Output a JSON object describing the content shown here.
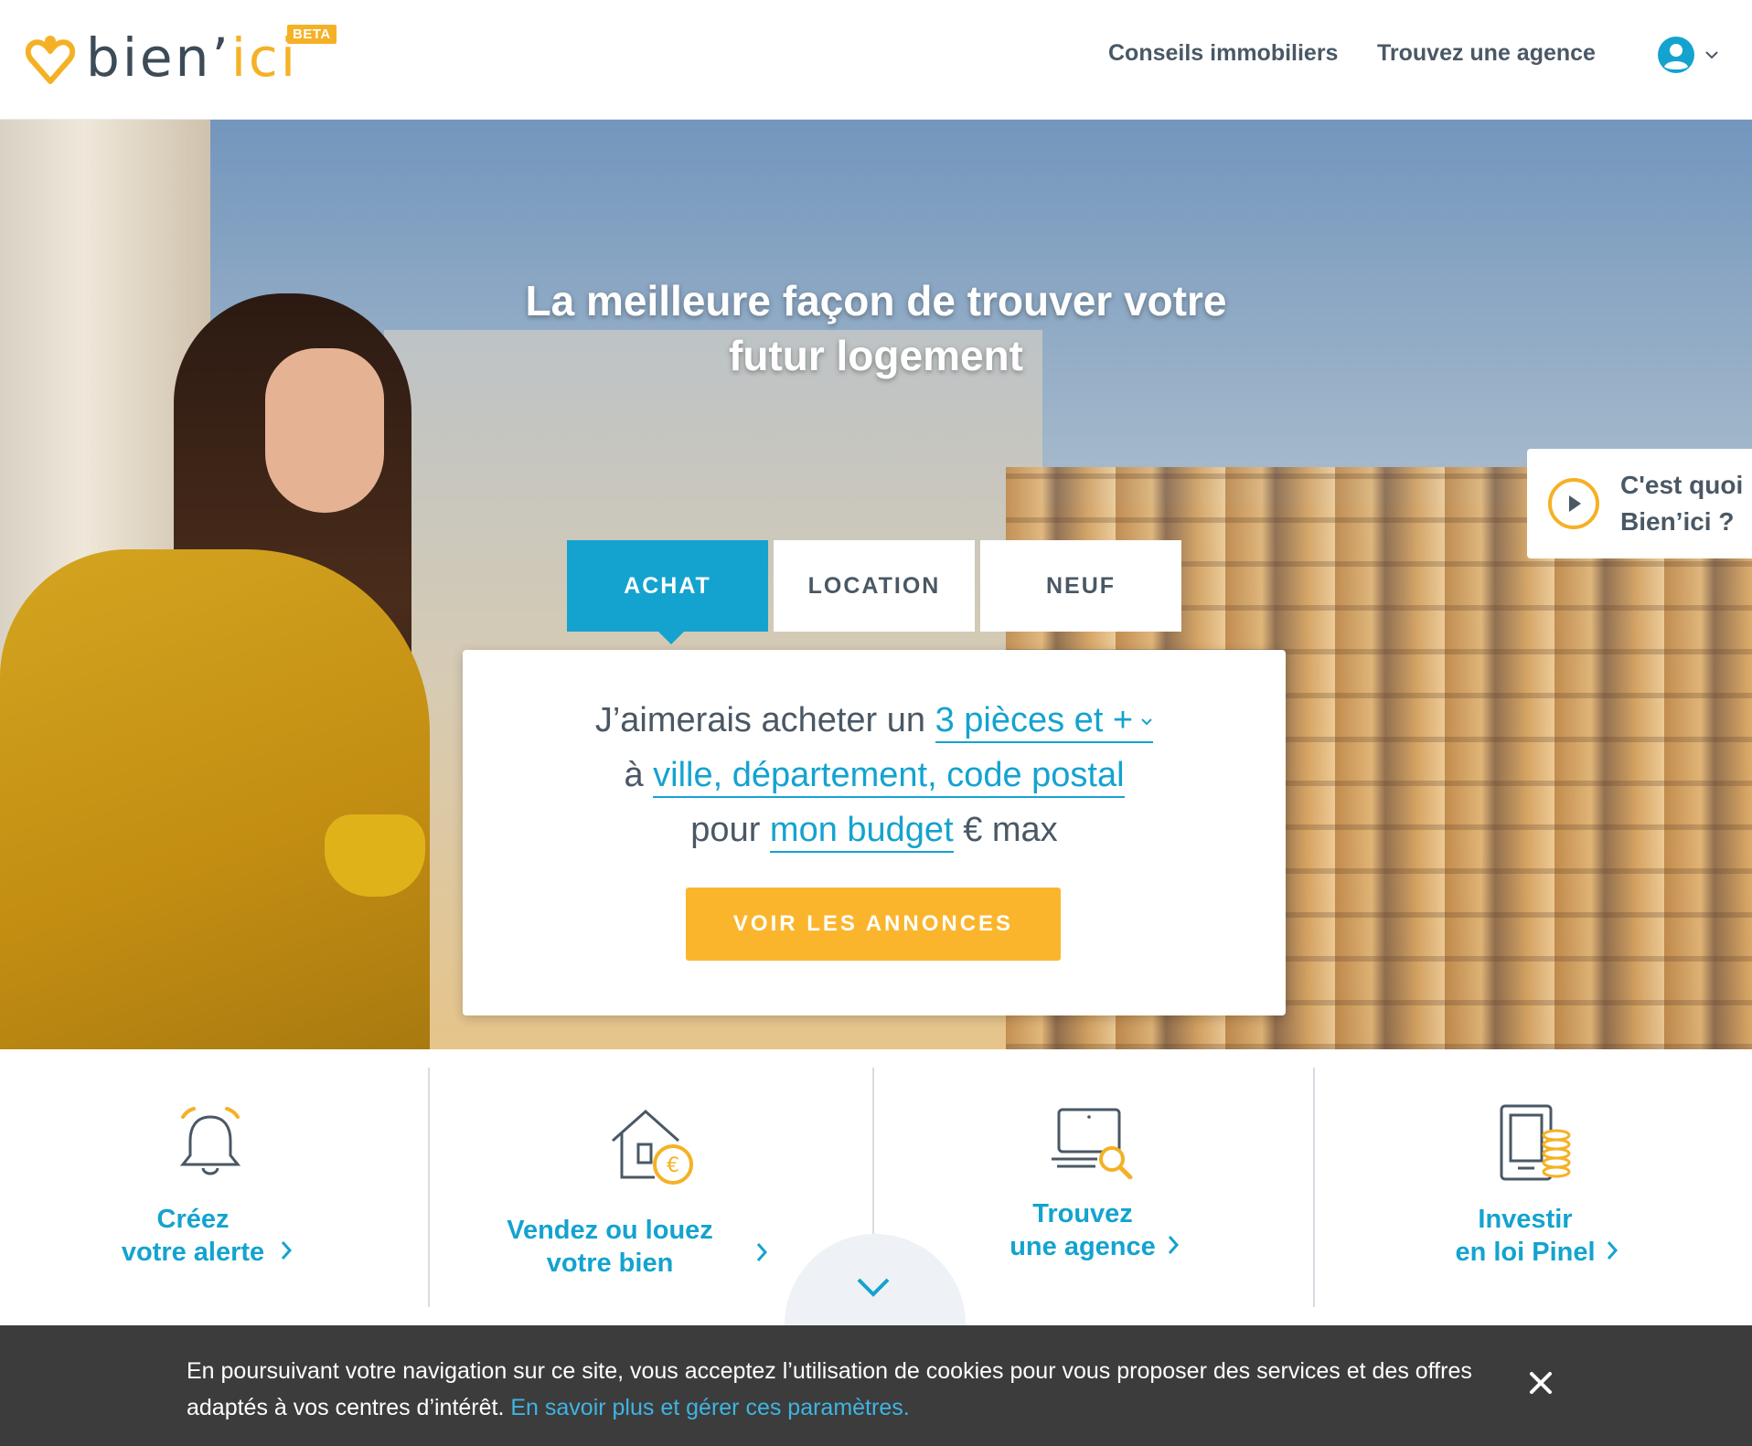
{
  "header": {
    "logo_text_left": "bien’",
    "logo_text_right": "ici",
    "beta_badge": "BETA",
    "nav": [
      {
        "label": "Conseils immobiliers"
      },
      {
        "label": "Trouvez une agence"
      }
    ]
  },
  "hero": {
    "title_line1": "La meilleure façon de trouver votre",
    "title_line2": "futur logement",
    "tabs": [
      {
        "label": "ACHAT",
        "active": true
      },
      {
        "label": "LOCATION",
        "active": false
      },
      {
        "label": "NEUF",
        "active": false
      }
    ],
    "search": {
      "line1_prefix": "J’aimerais acheter un ",
      "rooms_value": "3 pièces et +",
      "line2_prefix": "à ",
      "location_placeholder": "ville, département, code postal",
      "line3_prefix": "pour ",
      "budget_placeholder": "mon budget",
      "line3_suffix": " € max",
      "cta_label": "VOIR LES ANNONCES"
    },
    "what_is": {
      "line1": "C'est quoi",
      "line2": "Bien’ici ?"
    }
  },
  "features": [
    {
      "line1": "Créez",
      "line2": "votre alerte",
      "icon": "bell-icon"
    },
    {
      "line1": "Vendez ou louez",
      "line2": "votre bien",
      "icon": "house-euro-icon"
    },
    {
      "line1": "Trouvez",
      "line2": "une agence",
      "icon": "laptop-search-icon"
    },
    {
      "line1": "Investir",
      "line2": "en loi Pinel",
      "icon": "tablet-coins-icon"
    }
  ],
  "cookie": {
    "text": "En poursuivant votre navigation sur ce site, vous acceptez l’utilisation de cookies pour vous proposer des services et des offres adaptés à vos centres d’intérêt. ",
    "link": "En savoir plus et gérer ces paramètres."
  },
  "colors": {
    "brand_yellow": "#f5b125",
    "brand_blue": "#14a3cf",
    "cta_yellow": "#fbb52d",
    "text_dark": "#4a5865",
    "cookie_bg": "#3c3c3c"
  }
}
